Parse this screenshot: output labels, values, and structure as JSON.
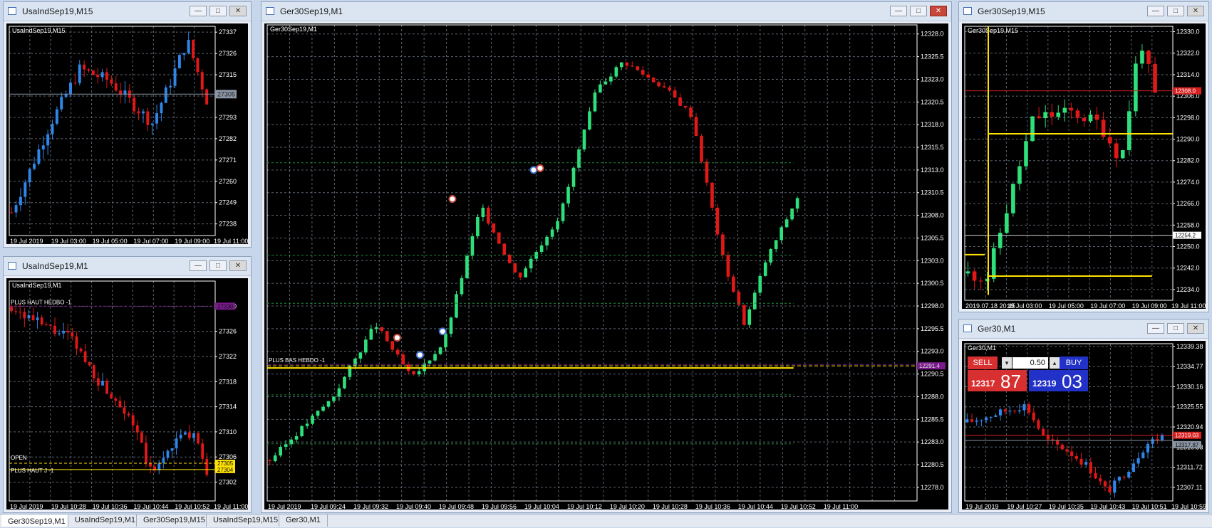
{
  "windows": {
    "w1": {
      "title": "UsaIndSep19,M15",
      "label": "UsaIndSep19,M15",
      "y_ticks": [
        "27337",
        "27326",
        "27315",
        "27304",
        "27293",
        "27282",
        "27271",
        "27260",
        "27249",
        "27238"
      ],
      "current_price": "27305",
      "x_ticks": [
        "19 Jul 2019",
        "19 Jul 03:00",
        "19 Jul 05:00",
        "19 Jul 07:00",
        "19 Jul 09:00",
        "19 Jul 11:00"
      ]
    },
    "w2": {
      "title": "UsaIndSep19,M1",
      "label": "UsaIndSep19,M1",
      "y_ticks": [
        "27330",
        "27326",
        "27322",
        "27318",
        "27314",
        "27310",
        "27306",
        "27302"
      ],
      "line_labels": {
        "plus_haut": "PLUS HAUT HEDBO -1",
        "open": "OPEN",
        "plus_haut_j": "PLUS HAUT J -1"
      },
      "level_tags": [
        "27330",
        "27305",
        "27304"
      ],
      "x_ticks": [
        "19 Jul 2019",
        "19 Jul 10:28",
        "19 Jul 10:36",
        "19 Jul 10:44",
        "19 Jul 10:52",
        "19 Jul 11:00"
      ]
    },
    "w3": {
      "title": "Ger30Sep19,M1",
      "label": "Ger30Sep19,M1",
      "y_ticks": [
        "12328.0",
        "12325.5",
        "12323.0",
        "12320.5",
        "12318.0",
        "12315.5",
        "12313.0",
        "12310.5",
        "12308.0",
        "12305.5",
        "12303.0",
        "12300.5",
        "12298.0",
        "12295.5",
        "12293.0",
        "12290.5",
        "12288.0",
        "12285.5",
        "12283.0",
        "12280.5",
        "12278.0"
      ],
      "line_label": "PLUS BAS HEBDO -1",
      "level_tag": "12291.4",
      "x_ticks": [
        "19 Jul 2019",
        "19 Jul 09:24",
        "19 Jul 09:32",
        "19 Jul 09:40",
        "19 Jul 09:48",
        "19 Jul 09:56",
        "19 Jul 10:04",
        "19 Jul 10:12",
        "19 Jul 10:20",
        "19 Jul 10:28",
        "19 Jul 10:36",
        "19 Jul 10:44",
        "19 Jul 10:52",
        "19 Jul 11:00"
      ]
    },
    "w4": {
      "title": "Ger30Sep19,M15",
      "label": "Ger30Sep19,M15",
      "y_ticks": [
        "12330.0",
        "12322.0",
        "12314.0",
        "12306.0",
        "12298.0",
        "12290.0",
        "12282.0",
        "12274.0",
        "12266.0",
        "12258.0",
        "12250.0",
        "12242.0",
        "12234.0"
      ],
      "level_tags": [
        "12308.0",
        "12254.2"
      ],
      "x_ticks": [
        "2019.07.18 20:45",
        "19 Jul 03:00",
        "19 Jul 05:00",
        "19 Jul 07:00",
        "19 Jul 09:00",
        "19 Jul 11:00"
      ]
    },
    "w5": {
      "title": "Ger30,M1",
      "label": "Ger30,M1",
      "y_ticks": [
        "12339.38",
        "12334.77",
        "12330.16",
        "12325.55",
        "12320.94",
        "12316.33",
        "12311.72",
        "12307.11"
      ],
      "level_tags": [
        "12319.03",
        "12317.87"
      ],
      "x_ticks": [
        "19 Jul 2019",
        "19 Jul 10:27",
        "19 Jul 10:35",
        "19 Jul 10:43",
        "19 Jul 10:51",
        "19 Jul 10:59"
      ],
      "trade": {
        "sell_label": "SELL",
        "buy_label": "BUY",
        "qty": "0.50",
        "sell_price_small": "12317",
        "sell_price_big": "87",
        "buy_price_small": "12319",
        "buy_price_big": "03"
      }
    }
  },
  "tabs": [
    "Ger30Sep19,M1",
    "UsaIndSep19,M1",
    "Ger30Sep19,M15",
    "UsaIndSep19,M15",
    "Ger30,M1"
  ],
  "active_tab": 0,
  "colors": {
    "bull": "#2fe07a",
    "bull_blue": "#2f86e8",
    "bear": "#e01818",
    "grid": "#5a6470",
    "axis_text": "#ffffff",
    "level_yellow": "#ffe200",
    "level_purple": "#7a1a8c",
    "level_red": "#d82020"
  }
}
